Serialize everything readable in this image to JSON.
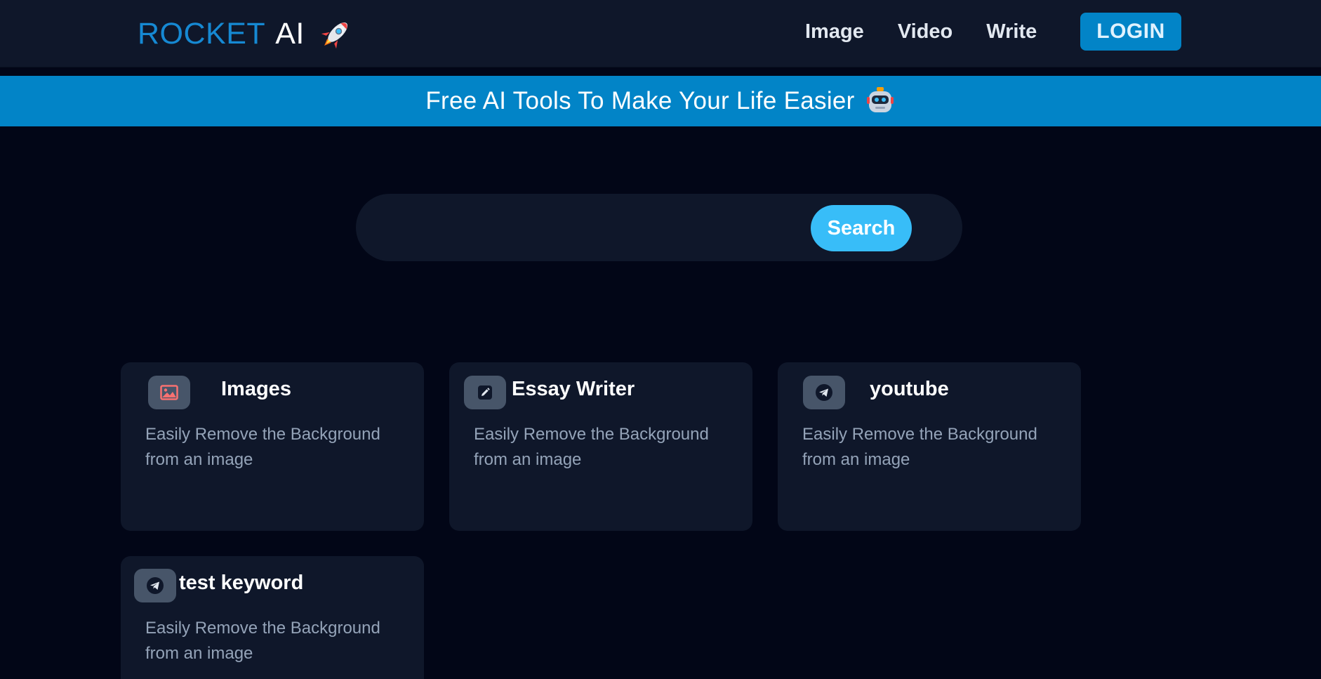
{
  "header": {
    "logo_word1": "ROCKET",
    "logo_word2": "AI",
    "logo_icon": "rocket-icon",
    "nav": [
      {
        "label": "Image"
      },
      {
        "label": "Video"
      },
      {
        "label": "Write"
      }
    ],
    "login_label": "LOGIN"
  },
  "banner": {
    "text": "Free AI Tools To Make Your Life Easier",
    "icon": "robot-icon"
  },
  "search": {
    "placeholder": "",
    "value": "",
    "button_label": "Search"
  },
  "tools": [
    {
      "title": "Images",
      "description": "Easily Remove the Background from an image",
      "icon": "image-icon"
    },
    {
      "title": "Essay Writer",
      "description": "Easily Remove the Background from an image",
      "icon": "pencil-icon"
    },
    {
      "title": "youtube",
      "description": "Easily Remove the Background from an image",
      "icon": "telegram-icon"
    },
    {
      "title": "test keyword",
      "description": "Easily Remove the Background from an image",
      "icon": "telegram-icon"
    }
  ],
  "colors": {
    "background": "#020617",
    "header": "#0f172a",
    "accent": "#0284c7",
    "search_button": "#38bdf8",
    "card": "#0f172a",
    "icon_bg": "#475569"
  }
}
